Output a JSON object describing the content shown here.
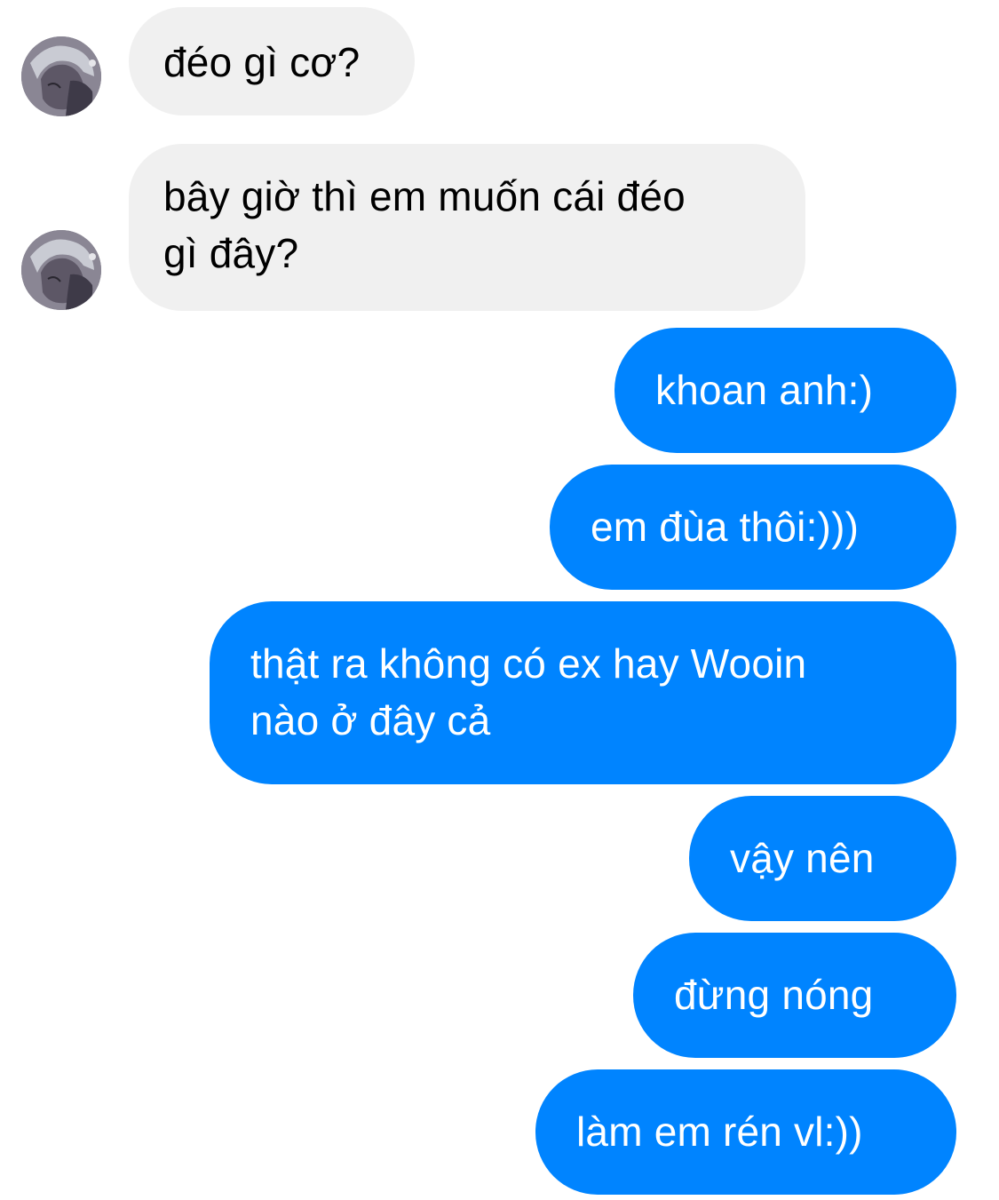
{
  "conversation": {
    "incoming": [
      {
        "lines": [
          "đéo gì cơ?"
        ]
      },
      {
        "lines": [
          "bây giờ thì em muốn cái đéo",
          "gì đây?"
        ]
      }
    ],
    "outgoing": [
      {
        "lines": [
          "khoan anh:)"
        ]
      },
      {
        "lines": [
          "em đùa thôi:)))"
        ]
      },
      {
        "lines": [
          "thật ra không có ex hay Wooin",
          "nào ở đây cả"
        ]
      },
      {
        "lines": [
          "vậy nên"
        ]
      },
      {
        "lines": [
          "đừng nóng"
        ]
      },
      {
        "lines": [
          "làm em rén vl:))"
        ]
      }
    ]
  },
  "contact": {
    "avatar_icon": "contact-avatar"
  },
  "colors": {
    "incoming_bubble": "#f0f0f0",
    "outgoing_bubble": "#0084ff",
    "incoming_text": "#000000",
    "outgoing_text": "#ffffff"
  }
}
